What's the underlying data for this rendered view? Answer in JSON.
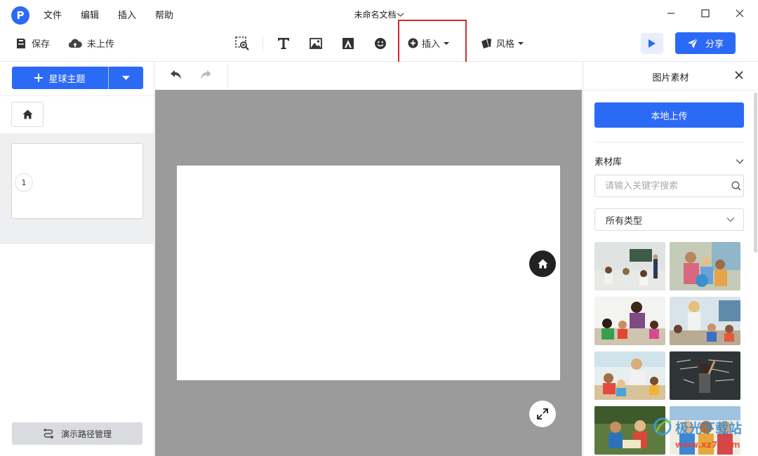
{
  "app": {
    "logo_letter": "P",
    "menu": [
      "文件",
      "编辑",
      "插入",
      "帮助"
    ],
    "doc_title": "未命名文档"
  },
  "toolbar": {
    "save_label": "保存",
    "upload_status": "未上传",
    "insert_label": "插入",
    "style_label": "风格",
    "share_label": "分享"
  },
  "left_panel": {
    "theme_button": "星球主题",
    "slides": [
      {
        "number": "1"
      }
    ],
    "path_button": "演示路径管理"
  },
  "right_panel": {
    "title": "图片素材",
    "upload_button": "本地上传",
    "library_label": "素材库",
    "search_placeholder": "请输入关键字搜索",
    "type_select": "所有类型"
  },
  "watermark": {
    "text": "极光下载站",
    "url": "www.xz7.com"
  },
  "colors": {
    "accent": "#2b6af5",
    "highlight_border": "#d62a2a",
    "canvas_bg": "#9b9b9b"
  }
}
